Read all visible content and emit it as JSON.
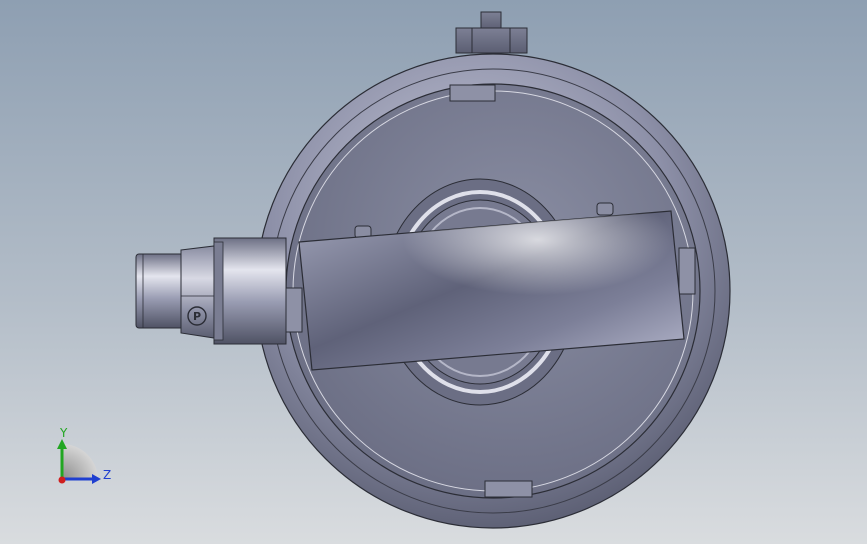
{
  "triad": {
    "y_label": "Y",
    "z_label": "Z"
  },
  "fitting": {
    "marking": "P"
  },
  "colors": {
    "background_top": "#8e9fb2",
    "background_bottom": "#d9dcdf",
    "part_metal": "#8b8fa6",
    "axis_y": "#22a622",
    "axis_z": "#1f3fd0",
    "axis_x": "#d01f1f"
  }
}
